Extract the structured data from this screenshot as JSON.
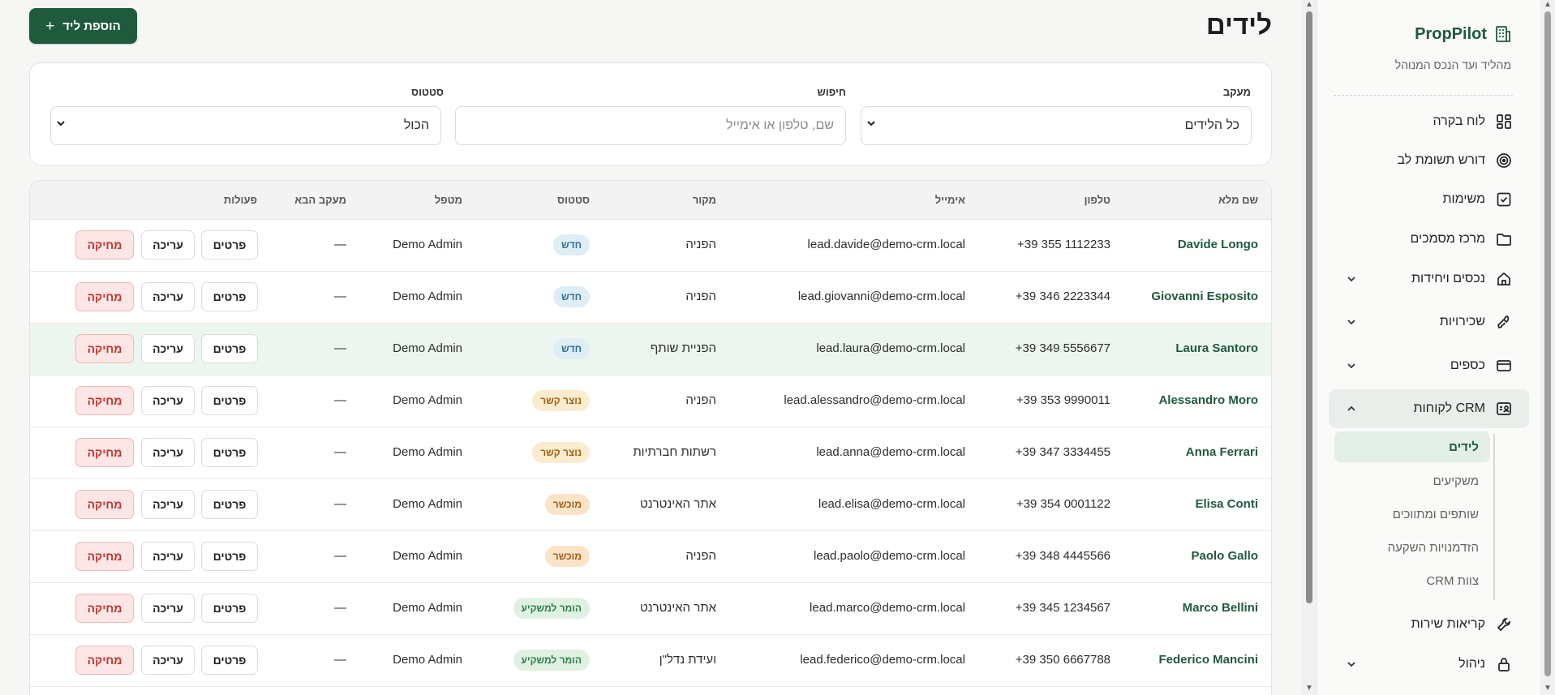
{
  "header": {
    "title": "לידים",
    "add_button": "הוספת ליד",
    "add_icon": "+"
  },
  "filters": {
    "tracking_label": "מעקב",
    "tracking_value": "כל הלידים",
    "search_label": "חיפוש",
    "search_placeholder": "שם, טלפון או אימייל",
    "status_label": "סטטוס",
    "status_value": "הכול"
  },
  "table": {
    "columns": [
      "שם מלא",
      "טלפון",
      "אימייל",
      "מקור",
      "סטטוס",
      "מטפל",
      "מעקב הבא",
      "פעולות"
    ],
    "actions": {
      "details": "פרטים",
      "edit": "עריכה",
      "delete": "מחיקה"
    },
    "rows": [
      {
        "name": "Davide Longo",
        "phone": "+39 355 1112233",
        "email": "lead.davide@demo-crm.local",
        "source": "הפניה",
        "status": "חדש",
        "status_kind": "new",
        "owner": "Demo Admin",
        "next": "—"
      },
      {
        "name": "Giovanni Esposito",
        "phone": "+39 346 2223344",
        "email": "lead.giovanni@demo-crm.local",
        "source": "הפניה",
        "status": "חדש",
        "status_kind": "new",
        "owner": "Demo Admin",
        "next": "—"
      },
      {
        "name": "Laura Santoro",
        "phone": "+39 349 5556677",
        "email": "lead.laura@demo-crm.local",
        "source": "הפניית שותף",
        "status": "חדש",
        "status_kind": "new",
        "owner": "Demo Admin",
        "next": "—"
      },
      {
        "name": "Alessandro Moro",
        "phone": "+39 353 9990011",
        "email": "lead.alessandro@demo-crm.local",
        "source": "הפניה",
        "status": "נוצר קשר",
        "status_kind": "contact",
        "owner": "Demo Admin",
        "next": "—"
      },
      {
        "name": "Anna Ferrari",
        "phone": "+39 347 3334455",
        "email": "lead.anna@demo-crm.local",
        "source": "רשתות חברתיות",
        "status": "נוצר קשר",
        "status_kind": "contact",
        "owner": "Demo Admin",
        "next": "—"
      },
      {
        "name": "Elisa Conti",
        "phone": "+39 354 0001122",
        "email": "lead.elisa@demo-crm.local",
        "source": "אתר האינטרנט",
        "status": "מוכשר",
        "status_kind": "won",
        "owner": "Demo Admin",
        "next": "—"
      },
      {
        "name": "Paolo Gallo",
        "phone": "+39 348 4445566",
        "email": "lead.paolo@demo-crm.local",
        "source": "הפניה",
        "status": "מוכשר",
        "status_kind": "won",
        "owner": "Demo Admin",
        "next": "—"
      },
      {
        "name": "Marco Bellini",
        "phone": "+39 345 1234567",
        "email": "lead.marco@demo-crm.local",
        "source": "אתר האינטרנט",
        "status": "הומר למשקיע",
        "status_kind": "inv",
        "owner": "Demo Admin",
        "next": "—"
      },
      {
        "name": "Federico Mancini",
        "phone": "+39 350 6667788",
        "email": "lead.federico@demo-crm.local",
        "source": "ועידת נדל\"ן",
        "status": "הומר למשקיע",
        "status_kind": "inv",
        "owner": "Demo Admin",
        "next": "—"
      }
    ]
  },
  "sidebar": {
    "brand": "PropPilot",
    "tagline": "מהליד ועד הנכס המנוהל",
    "items": [
      {
        "label": "לוח בקרה",
        "icon": "dashboard-icon"
      },
      {
        "label": "דורש תשומת לב",
        "icon": "target-icon"
      },
      {
        "label": "משימות",
        "icon": "checkbox-icon"
      },
      {
        "label": "מרכז מסמכים",
        "icon": "folder-icon"
      },
      {
        "label": "נכסים ויחידות",
        "icon": "home-icon"
      },
      {
        "label": "שכירויות",
        "icon": "key-icon"
      },
      {
        "label": "כספים",
        "icon": "card-icon"
      },
      {
        "label": "CRM לקוחות",
        "icon": "contact-card-icon"
      },
      {
        "label": "קריאות שירות",
        "icon": "wrench-icon"
      },
      {
        "label": "ניהול",
        "icon": "lock-icon"
      }
    ],
    "crm_sub": [
      "לידים",
      "משקיעים",
      "שותפים ומתווכים",
      "הזדמנויות השקעה",
      "צוות CRM"
    ]
  }
}
